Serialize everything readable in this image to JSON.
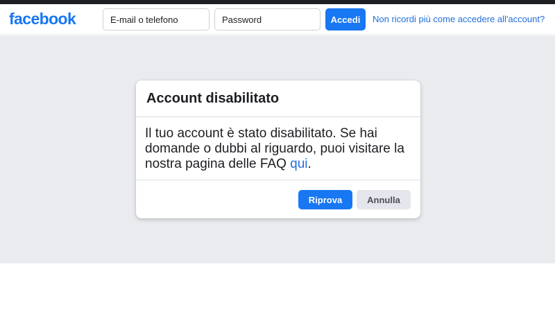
{
  "header": {
    "logo": "facebook",
    "email_placeholder": "E-mail o telefono",
    "password_placeholder": "Password",
    "login_label": "Accedi",
    "forgot_link": "Non ricordi più come accedere all'account?"
  },
  "dialog": {
    "title": "Account disabilitato",
    "message_text": "Il tuo account è stato disabilitato. Se hai domande o dubbi al riguardo, puoi visitare la nostra pagina delle FAQ ",
    "faq_link": "qui",
    "message_end": ".",
    "retry_label": "Riprova",
    "cancel_label": "Annulla"
  },
  "colors": {
    "brand": "#1877f2",
    "link": "#216fdb",
    "background": "#e9ebee"
  }
}
